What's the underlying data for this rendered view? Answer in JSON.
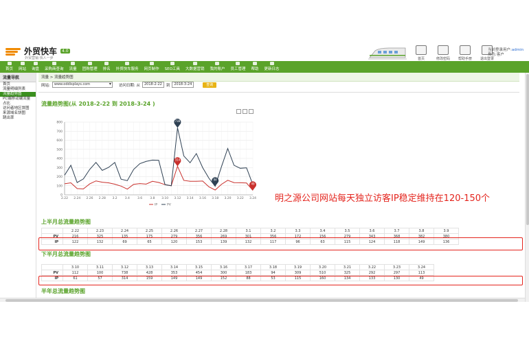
{
  "header": {
    "logo_text": "外贸快车",
    "logo_tag": "4.0",
    "logo_sub": "外贸营销 快人一步",
    "tools": [
      "首页",
      "修改密码",
      "帮助手册",
      "退出登录"
    ],
    "user_line1": "当前登录用户:",
    "user_name": "admin",
    "user_line2": "角色:",
    "user_role": "客户"
  },
  "nav": [
    "首页",
    "网站",
    "询盘",
    "采购商查询",
    "流量",
    "团购管理",
    "排名",
    "外贸快车服务",
    "网页制作",
    "SEO工具",
    "大数据营销",
    "我的账户",
    "员工管理",
    "帮助",
    "更新日志"
  ],
  "sidebar": {
    "title": "流量导航",
    "items": [
      "首页",
      "流量明细列表",
      "流量趋势图",
      "PC端移动端流量占比",
      "访问者地区饼图",
      "来源域名饼图",
      "跳出率"
    ],
    "active_index": 2
  },
  "breadcrumb": "流量 > 流量趋势图",
  "filter": {
    "site_label": "网站:",
    "site_value": "www.oddisplays.com",
    "date_label": "访问日期: 从",
    "date_from": "2018-2-22",
    "date_to_label": "到",
    "date_to": "2018-3-24",
    "query_button": "查询"
  },
  "chart_title": "流量趋势图(从 2018-2-22 到 2018-3-24 )",
  "annotation": "明之源公司网站每天独立访客IP稳定维持在120-150个",
  "chart_data": {
    "type": "line",
    "x": [
      "2.22",
      "2.23",
      "2.24",
      "2.25",
      "2.26",
      "2.27",
      "2.28",
      "3.1",
      "3.2",
      "3.3",
      "3.4",
      "3.5",
      "3.6",
      "3.7",
      "3.8",
      "3.9",
      "3.10",
      "3.11",
      "3.12",
      "3.13",
      "3.14",
      "3.15",
      "3.16",
      "3.17",
      "3.18",
      "3.19",
      "3.20",
      "3.21",
      "3.22",
      "3.23",
      "3.24"
    ],
    "x_tick_labels": [
      "2.22",
      "2.24",
      "2.26",
      "2.28",
      "3.2",
      "3.4",
      "3.6",
      "3.8",
      "3.10",
      "3.12",
      "3.14",
      "3.16",
      "3.18",
      "3.20",
      "3.22",
      "3.24"
    ],
    "ylim": [
      0,
      800
    ],
    "y_ticks": [
      0,
      100,
      200,
      300,
      400,
      500,
      600,
      700,
      800
    ],
    "grid": true,
    "legend_position": "bottom",
    "series": [
      {
        "name": "IP",
        "color": "#c9302c",
        "values": [
          122,
          132,
          69,
          65,
          120,
          153,
          139,
          132,
          117,
          96,
          63,
          115,
          124,
          118,
          149,
          136,
          112,
          100,
          314,
          159,
          149,
          149,
          152,
          88,
          53,
          115,
          160,
          134,
          133,
          130,
          49
        ]
      },
      {
        "name": "PV",
        "color": "#2e4053",
        "values": [
          216,
          325,
          135,
          175,
          279,
          356,
          269,
          301,
          356,
          172,
          156,
          279,
          343,
          368,
          382,
          380,
          112,
          100,
          738,
          428,
          353,
          454,
          300,
          183,
          94,
          309,
          510,
          325,
          292,
          297,
          113
        ]
      }
    ],
    "markers": [
      {
        "series": "PV",
        "x": "3.12",
        "label": "738"
      },
      {
        "series": "IP",
        "x": "3.12",
        "label": "314"
      },
      {
        "series": "PV",
        "x": "3.18",
        "label": "94"
      },
      {
        "series": "IP",
        "x": "3.24",
        "label": "49"
      }
    ]
  },
  "table1": {
    "title": "上半月总流量趋势图",
    "dates": [
      "2.22",
      "2.23",
      "2.24",
      "2.25",
      "2.26",
      "2.27",
      "2.28",
      "3.1",
      "3.2",
      "3.3",
      "3.4",
      "3.5",
      "3.6",
      "3.7",
      "3.8",
      "3.9"
    ],
    "pv": [
      "216",
      "325",
      "135",
      "175",
      "279",
      "356",
      "269",
      "301",
      "356",
      "172",
      "156",
      "279",
      "343",
      "368",
      "382",
      "380"
    ],
    "ip": [
      "122",
      "132",
      "69",
      "65",
      "120",
      "153",
      "139",
      "132",
      "117",
      "96",
      "63",
      "115",
      "124",
      "118",
      "149",
      "136"
    ]
  },
  "table2": {
    "title": "下半月总流量趋势图",
    "dates": [
      "3.10",
      "3.11",
      "3.12",
      "3.13",
      "3.14",
      "3.15",
      "3.16",
      "3.17",
      "3.18",
      "3.19",
      "3.20",
      "3.21",
      "3.22",
      "3.23",
      "3.24"
    ],
    "pv": [
      "112",
      "100",
      "738",
      "428",
      "353",
      "454",
      "300",
      "183",
      "94",
      "309",
      "510",
      "325",
      "292",
      "297",
      "113"
    ],
    "ip": [
      "61",
      "57",
      "314",
      "159",
      "149",
      "149",
      "152",
      "88",
      "53",
      "115",
      "160",
      "134",
      "133",
      "130",
      "49"
    ]
  },
  "table3_title": "半年总流量趋势图",
  "row_labels": {
    "pv": "PV",
    "ip": "IP"
  }
}
